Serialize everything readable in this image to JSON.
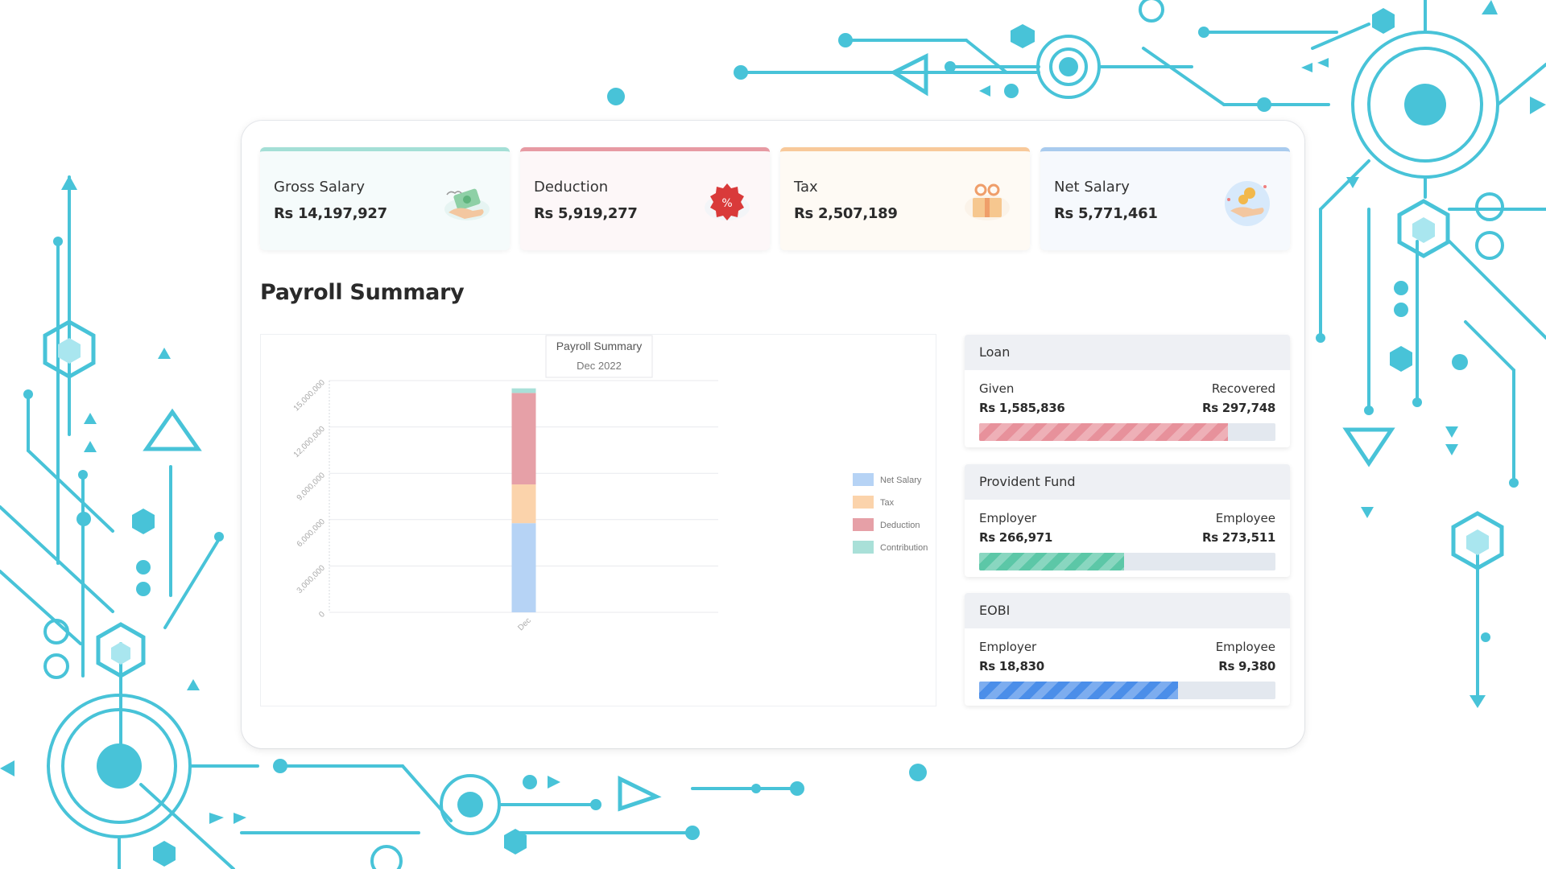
{
  "cards": [
    {
      "label": "Gross Salary",
      "value": "Rs 14,197,927",
      "accent": "#a4dfd6",
      "bg": "#f5fbfb",
      "icon": "money-hand-icon"
    },
    {
      "label": "Deduction",
      "value": "Rs 5,919,277",
      "accent": "#e79aa3",
      "bg": "#fdf7f8",
      "icon": "discount-badge-icon"
    },
    {
      "label": "Tax",
      "value": "Rs 2,507,189",
      "accent": "#f8c99a",
      "bg": "#fefaf4",
      "icon": "tax-gift-icon"
    },
    {
      "label": "Net Salary",
      "value": "Rs 5,771,461",
      "accent": "#a9cbee",
      "bg": "#f6f9fd",
      "icon": "coins-hand-icon"
    }
  ],
  "section_title": "Payroll Summary",
  "chart_data": {
    "type": "bar",
    "stacked": true,
    "title": "Payroll Summary",
    "subtitle": "Dec 2022",
    "categories": [
      "Dec"
    ],
    "yticks": [
      "0",
      "3,000,000",
      "6,000,000",
      "9,000,000",
      "12,000,000",
      "15,000,000"
    ],
    "ylim": [
      0,
      15000000
    ],
    "series": [
      {
        "name": "Net Salary",
        "color": "#b6d3f5",
        "values": [
          5771461
        ]
      },
      {
        "name": "Tax",
        "color": "#fbd3ab",
        "values": [
          2507189
        ]
      },
      {
        "name": "Deduction",
        "color": "#e6a0a7",
        "values": [
          5919277
        ]
      },
      {
        "name": "Contribution",
        "color": "#a9e0d8",
        "values": [
          300000
        ]
      }
    ],
    "legend_position": "right",
    "grid": true
  },
  "loan": {
    "title": "Loan",
    "left_label": "Given",
    "right_label": "Recovered",
    "left_value": "Rs 1,585,836",
    "right_value": "Rs 297,748",
    "progress": 0.84,
    "color": "#e7919b"
  },
  "provident_fund": {
    "title": "Provident Fund",
    "left_label": "Employer",
    "right_label": "Employee",
    "left_value": "Rs 266,971",
    "right_value": "Rs 273,511",
    "progress": 0.49,
    "color": "#5cc7a7"
  },
  "eobi": {
    "title": "EOBI",
    "left_label": "Employer",
    "right_label": "Employee",
    "left_value": "Rs 18,830",
    "right_value": "Rs 9,380",
    "progress": 0.67,
    "color": "#4b8ee9"
  },
  "decor_color": "#48c3d8"
}
